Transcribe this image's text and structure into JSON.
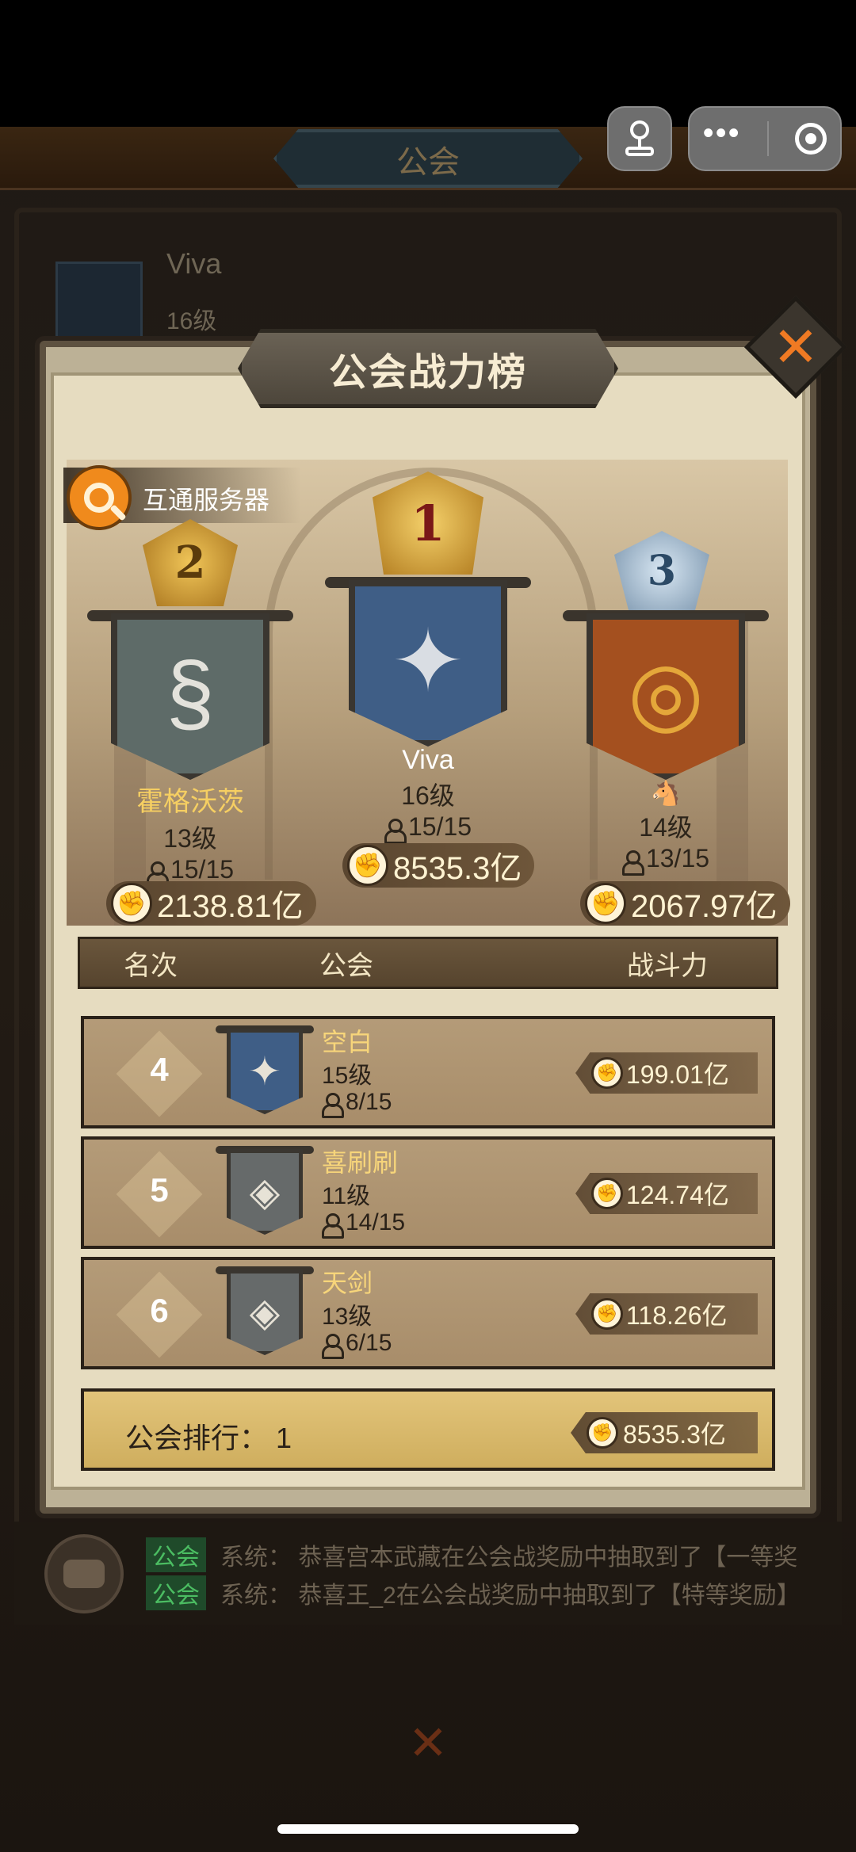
{
  "background": {
    "title": "公会",
    "guild_name": "Viva",
    "guild_level": "16级"
  },
  "capsule": {
    "more_icon": "more-dots-icon",
    "close_icon": "target-icon",
    "avatar_icon": "joystick-icon"
  },
  "modal": {
    "title": "公会战力榜",
    "close_icon": "close-x-icon",
    "cross_server": "互通服务器",
    "top3": [
      {
        "rank": "1",
        "name": "Viva",
        "level": "16级",
        "members": "15/15",
        "power": "8535.3亿",
        "banner_color": "#3f5e86",
        "emblem": "✦"
      },
      {
        "rank": "2",
        "name": "霍格沃茨",
        "level": "13级",
        "members": "15/15",
        "power": "2138.81亿",
        "banner_color": "#5e6b68",
        "emblem": "§"
      },
      {
        "rank": "3",
        "name": "🐴",
        "level": "14级",
        "members": "13/15",
        "power": "2067.97亿",
        "banner_color": "#a4501f",
        "emblem": "◎"
      }
    ],
    "headers": {
      "rank": "名次",
      "guild": "公会",
      "power": "战斗力"
    },
    "rows": [
      {
        "rank": "4",
        "name": "空白",
        "level": "15级",
        "members": "8/15",
        "power": "199.01亿",
        "banner_color": "#3f5e86",
        "emblem": "✦"
      },
      {
        "rank": "5",
        "name": "喜刷刷",
        "level": "11级",
        "members": "14/15",
        "power": "124.74亿",
        "banner_color": "#666a6a",
        "emblem": "◈"
      },
      {
        "rank": "6",
        "name": "天剑",
        "level": "13级",
        "members": "6/15",
        "power": "118.26亿",
        "banner_color": "#666a6a",
        "emblem": "◈"
      }
    ],
    "my_guild": {
      "label": "公会排行：  1",
      "power": "8535.3亿"
    }
  },
  "chat": {
    "lines": [
      {
        "tag": "公会",
        "text": "系统：  恭喜宫本武藏在公会战奖励中抽取到了【一等奖"
      },
      {
        "tag": "公会",
        "text": "系统：  恭喜王_2在公会战奖励中抽取到了【特等奖励】"
      }
    ]
  }
}
